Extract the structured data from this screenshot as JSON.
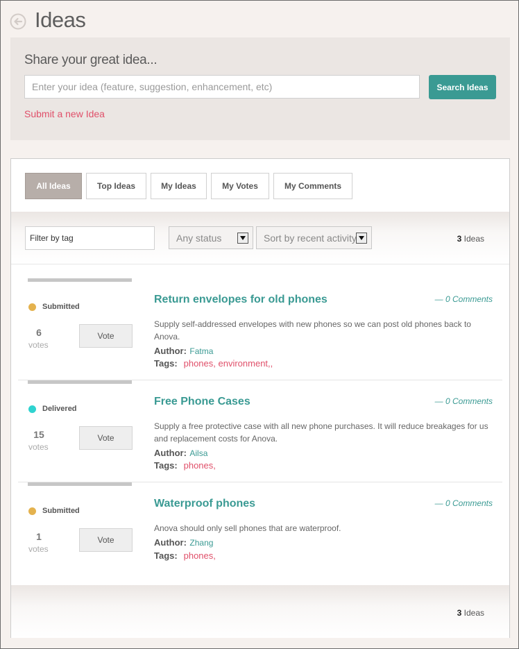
{
  "header": {
    "title": "Ideas",
    "back_icon": "back-arrow-circle-icon"
  },
  "share": {
    "heading": "Share your great idea...",
    "input_placeholder": "Enter your idea (feature, suggestion, enhancement, etc)",
    "input_value": "",
    "search_label": "Search Ideas",
    "submit_link": "Submit a new Idea"
  },
  "tabs": [
    {
      "label": "All Ideas",
      "active": true
    },
    {
      "label": "Top Ideas",
      "active": false
    },
    {
      "label": "My Ideas",
      "active": false
    },
    {
      "label": "My Votes",
      "active": false
    },
    {
      "label": "My Comments",
      "active": false
    }
  ],
  "filters": {
    "tag_placeholder": "Filter by tag",
    "status_selected": "Any status",
    "sort_selected": "Sort by recent activity",
    "count_number": "3",
    "count_unit": "Ideas"
  },
  "colors": {
    "accent": "#3a9a93",
    "link_pink": "#e0506a",
    "status_submitted": "#e4b24e",
    "status_delivered": "#2fd3d0"
  },
  "labels": {
    "author": "Author:",
    "tags": "Tags:",
    "votes": "votes",
    "vote_button": "Vote"
  },
  "ideas": [
    {
      "status": "Submitted",
      "votes": "6",
      "title": "Return envelopes for old phones",
      "comments": "— 0 Comments",
      "description": "Supply self-addressed envelopes with new phones so we can post old phones back to Anova.",
      "author": "Fatma",
      "tags": [
        "phones",
        "environment"
      ],
      "tags_trailing": ","
    },
    {
      "status": "Delivered",
      "votes": "15",
      "title": "Free Phone Cases",
      "comments": "— 0 Comments",
      "description": "Supply a free protective case with all new phone purchases. It will reduce breakages for us and replacement costs for Anova.",
      "author": "Ailsa",
      "tags": [
        "phones"
      ],
      "tags_trailing": ""
    },
    {
      "status": "Submitted",
      "votes": "1",
      "title": "Waterproof phones",
      "comments": "— 0 Comments",
      "description": "Anova should only sell phones that are waterproof.",
      "author": "Zhang",
      "tags": [
        "phones"
      ],
      "tags_trailing": ""
    }
  ],
  "footer": {
    "count_number": "3",
    "count_unit": "Ideas"
  }
}
